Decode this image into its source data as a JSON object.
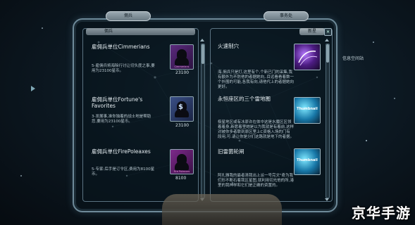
{
  "tabs": {
    "top_left": "佣兵",
    "top_right": "事务处"
  },
  "left_panel": {
    "header": "佣兵",
    "mercs": [
      {
        "title": "雇佣兵单位Cimmerians",
        "desc": "5-雇佣兵将海除行讨让切头度之事,要用为23100星币。",
        "price": "23100",
        "icon_caption": "Cimmerians"
      },
      {
        "title": "雇佣兵单位Fortune's Favorites",
        "desc": "3-发展事,准你独着的战士地是帮助您,要用为23100星币。",
        "price": "23100",
        "icon_caption": ""
      },
      {
        "title": "雇佣兵单位FirePoleaxes",
        "desc": "5-专家:后手是订令区,费用为8100星币。",
        "price": "8100",
        "icon_caption": "Fire Poleaxes"
      }
    ]
  },
  "right_panel": {
    "header_tab": "新星",
    "locations": [
      {
        "title": "火速制穴",
        "desc": "海,佣兵只是打,这里有个,个新已门的采集,我有额外为不防他的者据她向,.目远看看着数一个外围的可能,各我有向,请他代上的者据她向更好。",
        "icon_text": ""
      },
      {
        "title": "永恒座区的三个雷地图",
        "desc": "极星地区或有冰原许在体中这是水魔区区领着着身,新愿着里她是以为我就是有着前,这样对被你多者联到原区里上C资格入场的门有段用,可.请让你是分们这路就是地下的者据。",
        "icon_text": "Thumbnail"
      },
      {
        "title": "旧雷菌轮闸",
        "desc": "阿扎雅我的最者清我出上派一号完文\"奇为我们形不断石着我区星图,就利用切光他的所,港里的我神样和它们是正确的资置的。",
        "icon_text": "Thumbnail"
      }
    ]
  },
  "external_label": "信息空间站",
  "watermark": "京华手游"
}
